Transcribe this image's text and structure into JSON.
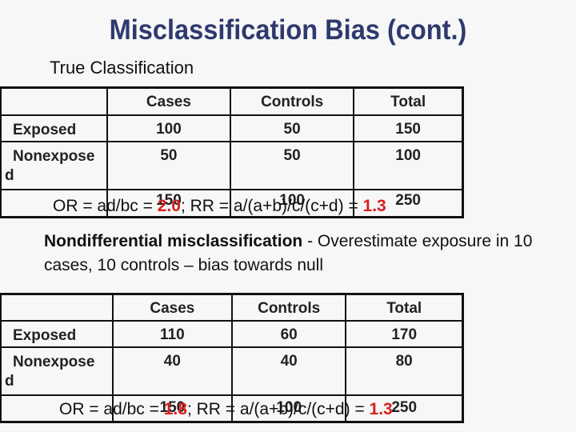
{
  "slide": {
    "title": "Misclassification Bias (cont.)",
    "subtitle": "True Classification"
  },
  "table_true": {
    "headers": [
      "",
      "Cases",
      "Controls",
      "Total"
    ],
    "rows": [
      {
        "label": "Exposed",
        "cases": "100",
        "controls": "50",
        "total": "150"
      },
      {
        "label": "Nonexposed",
        "label_line1": "Nonexpose",
        "label_line2": "d",
        "cases": "50",
        "controls": "50",
        "total": "100"
      }
    ],
    "totals": {
      "cases": "150",
      "controls": "100",
      "total": "250"
    }
  },
  "formula_true": {
    "or_text": "OR = ad/bc = ",
    "or_value": "2.0",
    "sep": ";  ",
    "rr_text": "RR = a/(a+b)/c/(c+d) = ",
    "rr_value": "1.3"
  },
  "note": {
    "bold": "Nondifferential misclassification",
    "rest": " - Overestimate exposure in 10 cases, 10 controls – bias towards null"
  },
  "table_misclassified": {
    "headers": [
      "",
      "Cases",
      "Controls",
      "Total"
    ],
    "rows": [
      {
        "label": "Exposed",
        "cases": "110",
        "controls": "60",
        "total": "170"
      },
      {
        "label": "Nonexposed",
        "label_line1": "Nonexpose",
        "label_line2": "d",
        "cases": "40",
        "controls": "40",
        "total": "80"
      }
    ],
    "totals": {
      "cases": "150",
      "controls": "100",
      "total": "250"
    }
  },
  "formula_misclassified": {
    "or_text": "OR = ad/bc = ",
    "or_value": "1.8",
    "sep": ";  ",
    "rr_text": "RR = a/(a+b)/c/(c+d) = ",
    "rr_value": "1.3"
  },
  "colors": {
    "title": "#2e3a6e",
    "highlight": "#d6201f",
    "background": "#f7f7f7"
  }
}
